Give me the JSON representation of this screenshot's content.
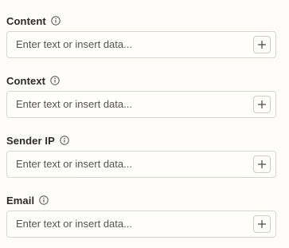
{
  "fields": [
    {
      "label": "Content",
      "icon": "info-icon",
      "placeholder": "Enter text or insert data...",
      "value": "",
      "button_icon": "plus-icon"
    },
    {
      "label": "Context",
      "icon": "info-icon",
      "placeholder": "Enter text or insert data...",
      "value": "",
      "button_icon": "plus-icon"
    },
    {
      "label": "Sender IP",
      "icon": "info-icon",
      "placeholder": "Enter text or insert data...",
      "value": "",
      "button_icon": "plus-icon"
    },
    {
      "label": "Email",
      "icon": "info-icon",
      "placeholder": "Enter text or insert data...",
      "value": "",
      "button_icon": "plus-icon"
    }
  ],
  "colors": {
    "background": "#fdfcf9",
    "label_text": "#2b2a27",
    "placeholder_text": "#55534e",
    "input_border": "#d9d6cf"
  }
}
